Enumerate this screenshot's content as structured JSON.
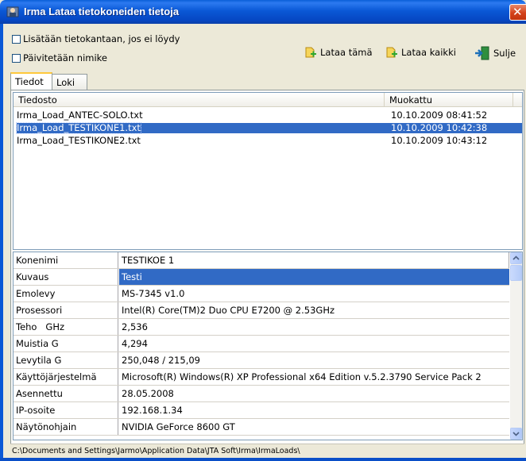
{
  "window": {
    "title": "Irma  Lataa tietokoneiden tietoja"
  },
  "options": {
    "add_to_db": "Lisätään tietokantaan, jos ei löydy",
    "update_name": "Päivitetään nimike"
  },
  "toolbar": {
    "load_this": "Lataa tämä",
    "load_all": "Lataa kaikki",
    "close": "Sulje"
  },
  "tabs": [
    "Tiedot",
    "Loki"
  ],
  "files": {
    "columns": [
      "Tiedosto",
      "Muokattu"
    ],
    "rows": [
      {
        "name": "Irma_Load_ANTEC-SOLO.txt",
        "modified": "10.10.2009 08:41:52",
        "selected": false
      },
      {
        "name": "Irma_Load_TESTIKONE1.txt",
        "modified": "10.10.2009 10:42:38",
        "selected": true
      },
      {
        "name": "Irma_Load_TESTIKONE2.txt",
        "modified": "10.10.2009 10:43:12",
        "selected": false
      }
    ]
  },
  "properties": [
    {
      "label": "Konenimi",
      "value": "TESTIKOE 1"
    },
    {
      "label": "Kuvaus",
      "value": "Testi"
    },
    {
      "label": "Emolevy",
      "value": "MS-7345 v1.0"
    },
    {
      "label": "Prosessori",
      "value": "Intel(R) Core(TM)2 Duo CPU E7200 @ 2.53GHz"
    },
    {
      "label": "Teho   GHz",
      "value": "2,536"
    },
    {
      "label": "Muistia G",
      "value": "4,294"
    },
    {
      "label": "Levytila G",
      "value": "250,048 / 215,09"
    },
    {
      "label": "Käyttöjärjestelmä",
      "value": "Microsoft(R) Windows(R) XP Professional x64 Edition v.5.2.3790 Service Pack 2"
    },
    {
      "label": "Asennettu",
      "value": "28.05.2008"
    },
    {
      "label": "IP-osoite",
      "value": "192.168.1.34"
    },
    {
      "label": "Näytönohjain",
      "value": "NVIDIA GeForce 8600 GT"
    }
  ],
  "status": {
    "path": "C:\\Documents and Settings\\Jarmo\\Application Data\\JTA Soft\\Irma\\IrmaLoads\\"
  },
  "colors": {
    "titlebar": "#0a58d6",
    "selection": "#316ac5",
    "window_bg": "#ece9d8"
  }
}
